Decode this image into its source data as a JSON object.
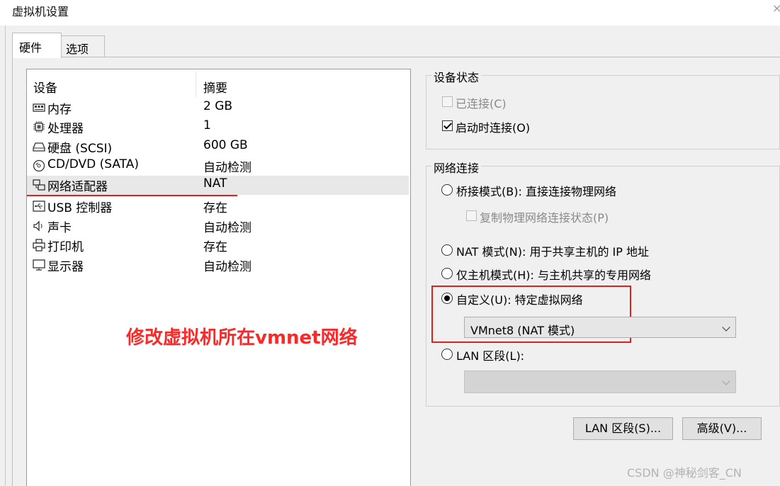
{
  "window": {
    "title": "虚拟机设置"
  },
  "tabs": [
    {
      "label": "硬件"
    },
    {
      "label": "选项"
    }
  ],
  "device_list": {
    "headers": {
      "device": "设备",
      "summary": "摘要"
    },
    "rows": [
      {
        "name": "内存",
        "summary": "2 GB",
        "icon": "memory-icon"
      },
      {
        "name": "处理器",
        "summary": "1",
        "icon": "processor-icon"
      },
      {
        "name": "硬盘 (SCSI)",
        "summary": "600 GB",
        "icon": "hard-disk-icon"
      },
      {
        "name": "CD/DVD (SATA)",
        "summary": "自动检测",
        "icon": "cd-dvd-icon"
      },
      {
        "name": "网络适配器",
        "summary": "NAT",
        "icon": "network-adapter-icon",
        "selected": true
      },
      {
        "name": "USB 控制器",
        "summary": "存在",
        "icon": "usb-icon"
      },
      {
        "name": "声卡",
        "summary": "自动检测",
        "icon": "speaker-icon"
      },
      {
        "name": "打印机",
        "summary": "存在",
        "icon": "printer-icon"
      },
      {
        "name": "显示器",
        "summary": "自动检测",
        "icon": "monitor-icon"
      }
    ]
  },
  "annotation": {
    "text": "修改虚拟机所在vmnet网络",
    "color": "#ff2828"
  },
  "device_status": {
    "title": "设备状态",
    "connected": {
      "label": "已连接(C)",
      "checked": false,
      "enabled": false
    },
    "connect_at_power_on": {
      "label": "启动时连接(O)",
      "checked": true,
      "enabled": true
    }
  },
  "network_connection": {
    "title": "网络连接",
    "bridged": {
      "label": "桥接模式(B): 直接连接物理网络",
      "checked": false
    },
    "replicate": {
      "label": "复制物理网络连接状态(P)",
      "checked": false,
      "enabled": false
    },
    "nat": {
      "label": "NAT 模式(N): 用于共享主机的 IP 地址",
      "checked": false
    },
    "host_only": {
      "label": "仅主机模式(H): 与主机共享的专用网络",
      "checked": false
    },
    "custom": {
      "label": "自定义(U): 特定虚拟网络",
      "checked": true
    },
    "custom_select": {
      "value": "VMnet8 (NAT 模式)"
    },
    "lan_segment": {
      "label": "LAN 区段(L):",
      "checked": false
    },
    "lan_select": {
      "value": ""
    }
  },
  "buttons": {
    "lan_segments": "LAN 区段(S)...",
    "advanced": "高级(V)..."
  },
  "watermark": "CSDN @神秘剑客_CN",
  "colors": {
    "highlight_red": "#e02020",
    "selected_row": "#e8e8e8"
  }
}
